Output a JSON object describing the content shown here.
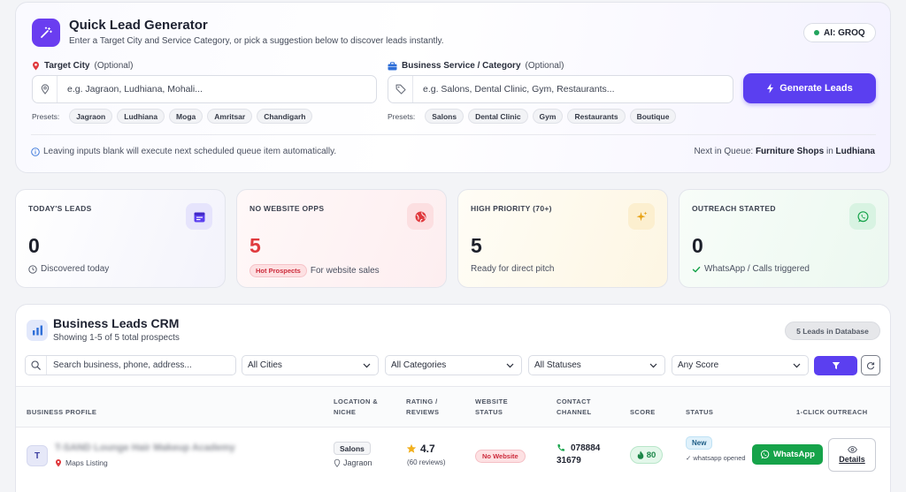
{
  "generator": {
    "title": "Quick Lead Generator",
    "subtitle": "Enter a Target City and Service Category, or pick a suggestion below to discover leads instantly.",
    "ai_badge": "AI: GROQ",
    "city_label": "Target City",
    "city_optional": "(Optional)",
    "city_placeholder": "e.g. Jagraon, Ludhiana, Mohali...",
    "service_label": "Business Service / Category",
    "service_optional": "(Optional)",
    "service_placeholder": "e.g. Salons, Dental Clinic, Gym, Restaurants...",
    "presets_label": "Presets:",
    "city_presets": [
      "Jagraon",
      "Ludhiana",
      "Moga",
      "Amritsar",
      "Chandigarh"
    ],
    "service_presets": [
      "Salons",
      "Dental Clinic",
      "Gym",
      "Restaurants",
      "Boutique"
    ],
    "generate_button": "Generate Leads",
    "note": "Leaving inputs blank will execute next scheduled queue item automatically.",
    "queue_prefix": "Next in Queue:",
    "queue_item": "Furniture Shops",
    "queue_in": "in",
    "queue_city": "Ludhiana"
  },
  "stats": [
    {
      "label": "TODAY'S LEADS",
      "value": "0",
      "caption": "Discovered today",
      "icon": "calendar-icon",
      "accent": "#5b3ff0"
    },
    {
      "label": "NO WEBSITE OPPS",
      "value": "5",
      "badge": "Hot Prospects",
      "caption": "For website sales",
      "icon": "globe-icon",
      "accent": "#e03a3e"
    },
    {
      "label": "HIGH PRIORITY (70+)",
      "value": "5",
      "caption": "Ready for direct pitch",
      "icon": "sparkle-icon",
      "accent": "#e8a317"
    },
    {
      "label": "OUTREACH STARTED",
      "value": "0",
      "caption": "WhatsApp / Calls triggered",
      "icon": "whatsapp-icon",
      "accent": "#16a34a"
    }
  ],
  "crm": {
    "title": "Business Leads CRM",
    "subtitle": "Showing 1-5 of 5 total prospects",
    "db_badge": "5 Leads in Database",
    "search_placeholder": "Search business, phone, address...",
    "filters": {
      "city": "All Cities",
      "category": "All Categories",
      "status": "All Statuses",
      "score": "Any Score"
    },
    "columns": [
      "BUSINESS PROFILE",
      "LOCATION & NICHE",
      "RATING / REVIEWS",
      "WEBSITE STATUS",
      "CONTACT CHANNEL",
      "SCORE",
      "STATUS",
      "1-CLICK OUTREACH"
    ],
    "rows": [
      {
        "initial": "T",
        "name": "T-SAND Lounge Hair Makeup Academy",
        "source": "Maps Listing",
        "niche": "Salons",
        "city": "Jagraon",
        "rating": "4.7",
        "reviews": "(60 reviews)",
        "website": "No Website",
        "phone_a": "078884",
        "phone_b": "31679",
        "score": "80",
        "status": "New",
        "status_note": "whatsapp opened",
        "whatsapp_button": "WhatsApp",
        "details_button": "Details"
      }
    ]
  },
  "colors": {
    "primary": "#5b3ff0",
    "danger": "#e03a3e",
    "success": "#16a34a",
    "warning": "#e8a317"
  }
}
